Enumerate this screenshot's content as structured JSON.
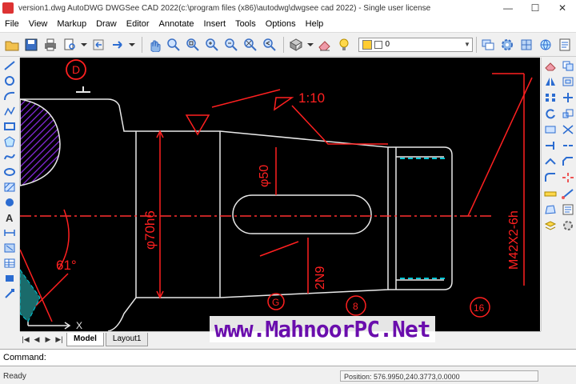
{
  "window": {
    "title": "version1.dwg AutoDWG DWGSee CAD 2022(c:\\program files (x86)\\autodwg\\dwgsee cad 2022) - Single user license",
    "minimize_glyph": "—",
    "maximize_glyph": "☐",
    "close_glyph": "✕"
  },
  "menu": [
    "File",
    "View",
    "Markup",
    "Draw",
    "Editor",
    "Annotate",
    "Insert",
    "Tools",
    "Options",
    "Help"
  ],
  "toolbar": {
    "icons": [
      "open-folder",
      "save-disk",
      "print",
      "print-preview",
      "arrow-back",
      "arrow-forward",
      "pan-hand",
      "zoom-realtime",
      "zoom-window",
      "zoom-in",
      "zoom-out",
      "zoom-extents",
      "view-3d",
      "eraser",
      "layer-bulb"
    ],
    "layer_value": "0"
  },
  "left_palette_icons": [
    "line",
    "circle",
    "arc",
    "polyline",
    "rectangle",
    "polygon",
    "spline",
    "ellipse",
    "hatch",
    "text",
    "dimension",
    "block",
    "region",
    "table",
    "point",
    "grip"
  ],
  "right_palette_icons": [
    "erase",
    "copy",
    "mirror",
    "offset",
    "array",
    "move",
    "rotate",
    "scale",
    "stretch",
    "trim",
    "extend",
    "break",
    "join",
    "chamfer",
    "fillet",
    "explode",
    "measure",
    "distance",
    "area",
    "properties",
    "layers",
    "settings"
  ],
  "drawing": {
    "callout_circle": "D",
    "scale_label": "1:10",
    "dim_diameter_50": "φ50",
    "dim_diameter_70": "φ70h6",
    "angle_label": "61°",
    "keyway_label": "2N9",
    "thread_label": "M42X2-6h",
    "small_circle_labels": [
      "G",
      "8",
      "16"
    ],
    "ucs_x": "X",
    "colors": {
      "background": "#000000",
      "dim": "#ff2020",
      "outline": "#e8e8e8",
      "hatch": "#8a2be2",
      "thread": "#00c8d8",
      "center": "#ff3030"
    }
  },
  "tabs": {
    "arrows": [
      "|◀",
      "◀",
      "▶",
      "▶|"
    ],
    "items": [
      "Model",
      "Layout1"
    ],
    "active": "Model"
  },
  "command": {
    "label": "Command:"
  },
  "status": {
    "left": "Ready",
    "position": "Position: 576.9950,240.3773,0.0000"
  },
  "watermark": "www.MahnoorPC.Net"
}
